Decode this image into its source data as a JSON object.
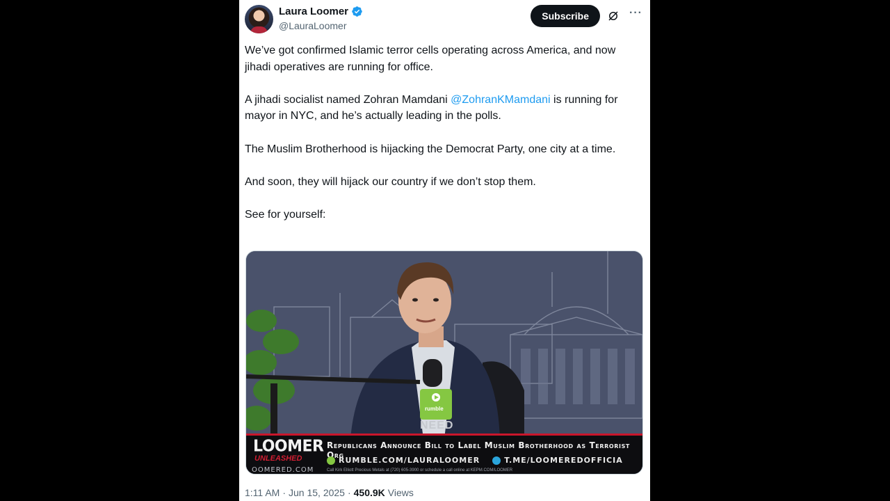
{
  "author": {
    "name": "Laura Loomer",
    "handle": "@LauraLoomer"
  },
  "actions": {
    "subscribe_label": "Subscribe",
    "more_label": "···"
  },
  "tweet": {
    "paragraphs": [
      {
        "text": "We’ve got confirmed Islamic terror cells operating across America, and now jihadi operatives are running for office."
      },
      {
        "before": "A jihadi socialist named Zohran Mamdani ",
        "mention": "@ZohranKMamdani",
        "after": " is running for mayor in NYC, and he’s actually leading in the polls."
      },
      {
        "text": "The Muslim Brotherhood is hijacking the Democrat Party, one city at a time."
      },
      {
        "text": "And soon, they will hijack our country if we don’t stop them."
      },
      {
        "text": "See for yourself:"
      }
    ]
  },
  "video": {
    "brand": "LOOMER",
    "brand_sub": "UNLEASHED",
    "domain": "OOMERED.COM",
    "headline": "Republicans Announce Bill to Label Muslim Brotherhood as Terrorist Org",
    "url_rumble": "RUMBLE.COM/LAURALOOMER",
    "url_telegram": "T.ME/LOOMEREDOFFICIA",
    "ticker": "Call Kirk Elliott Precious Metals at (720) 605-3900 or schedule a call online at KEPM.COM/LOOMER",
    "mic_label": "rumble",
    "desk_text": "NEED"
  },
  "footer": {
    "time": "1:11 AM",
    "separator": "·",
    "date": "Jun 15, 2025",
    "views_count": "450.9K",
    "views_label": "Views"
  },
  "colors": {
    "accent": "#1d9bf0",
    "text": "#0f1419",
    "muted": "#536471",
    "brand_red": "#c9162b",
    "rumble_green": "#85c742"
  }
}
